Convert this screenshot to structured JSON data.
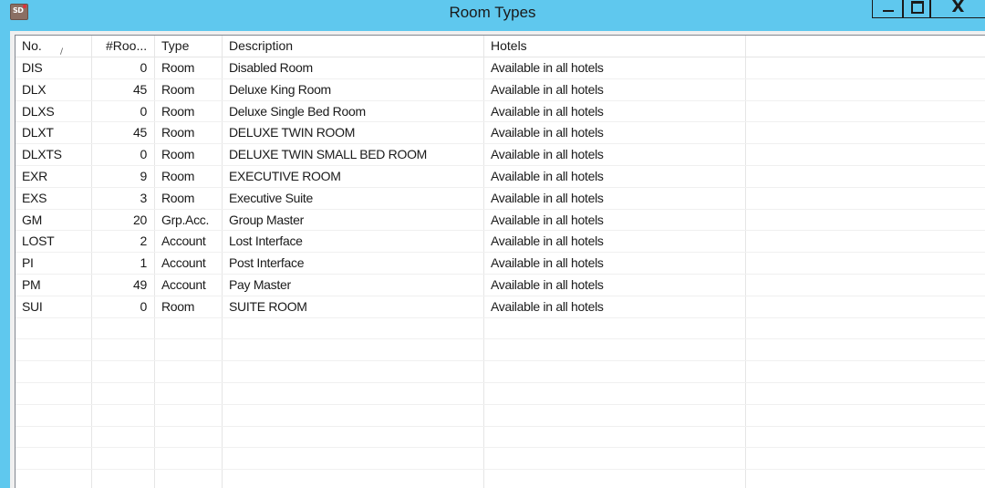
{
  "window": {
    "title": "Room Types",
    "app_icon_label": "SD",
    "close_glyph": "X"
  },
  "columns": [
    "No.",
    "#Roo...",
    "Type",
    "Description",
    "Hotels",
    ""
  ],
  "sort_indicator": "/",
  "rows": [
    {
      "no": "DIS",
      "rooms": "0",
      "type": "Room",
      "description": "Disabled Room",
      "hotels": "Available in all hotels"
    },
    {
      "no": "DLX",
      "rooms": "45",
      "type": "Room",
      "description": "Deluxe King Room",
      "hotels": "Available in all hotels"
    },
    {
      "no": "DLXS",
      "rooms": "0",
      "type": "Room",
      "description": "Deluxe Single Bed Room",
      "hotels": "Available in all hotels"
    },
    {
      "no": "DLXT",
      "rooms": "45",
      "type": "Room",
      "description": "DELUXE TWIN  ROOM",
      "hotels": "Available in all hotels"
    },
    {
      "no": "DLXTS",
      "rooms": "0",
      "type": "Room",
      "description": "DELUXE TWIN SMALL BED ROOM",
      "hotels": "Available in all hotels"
    },
    {
      "no": "EXR",
      "rooms": "9",
      "type": "Room",
      "description": "EXECUTIVE ROOM",
      "hotels": "Available in all hotels"
    },
    {
      "no": "EXS",
      "rooms": "3",
      "type": "Room",
      "description": "Executive Suite",
      "hotels": "Available in all hotels"
    },
    {
      "no": "GM",
      "rooms": "20",
      "type": "Grp.Acc.",
      "description": "Group Master",
      "hotels": "Available in all hotels"
    },
    {
      "no": "LOST",
      "rooms": "2",
      "type": "Account",
      "description": "Lost Interface",
      "hotels": "Available in all hotels"
    },
    {
      "no": "PI",
      "rooms": "1",
      "type": "Account",
      "description": "Post Interface",
      "hotels": "Available in all hotels"
    },
    {
      "no": "PM",
      "rooms": "49",
      "type": "Account",
      "description": "Pay Master",
      "hotels": "Available in all hotels"
    },
    {
      "no": "SUI",
      "rooms": "0",
      "type": "Room",
      "description": "SUITE ROOM",
      "hotels": "Available in all hotels"
    }
  ],
  "colors": {
    "titlebar": "#5fc8ee",
    "grid_background": "#ffffff",
    "grid_lines": "#e5e5e5"
  }
}
